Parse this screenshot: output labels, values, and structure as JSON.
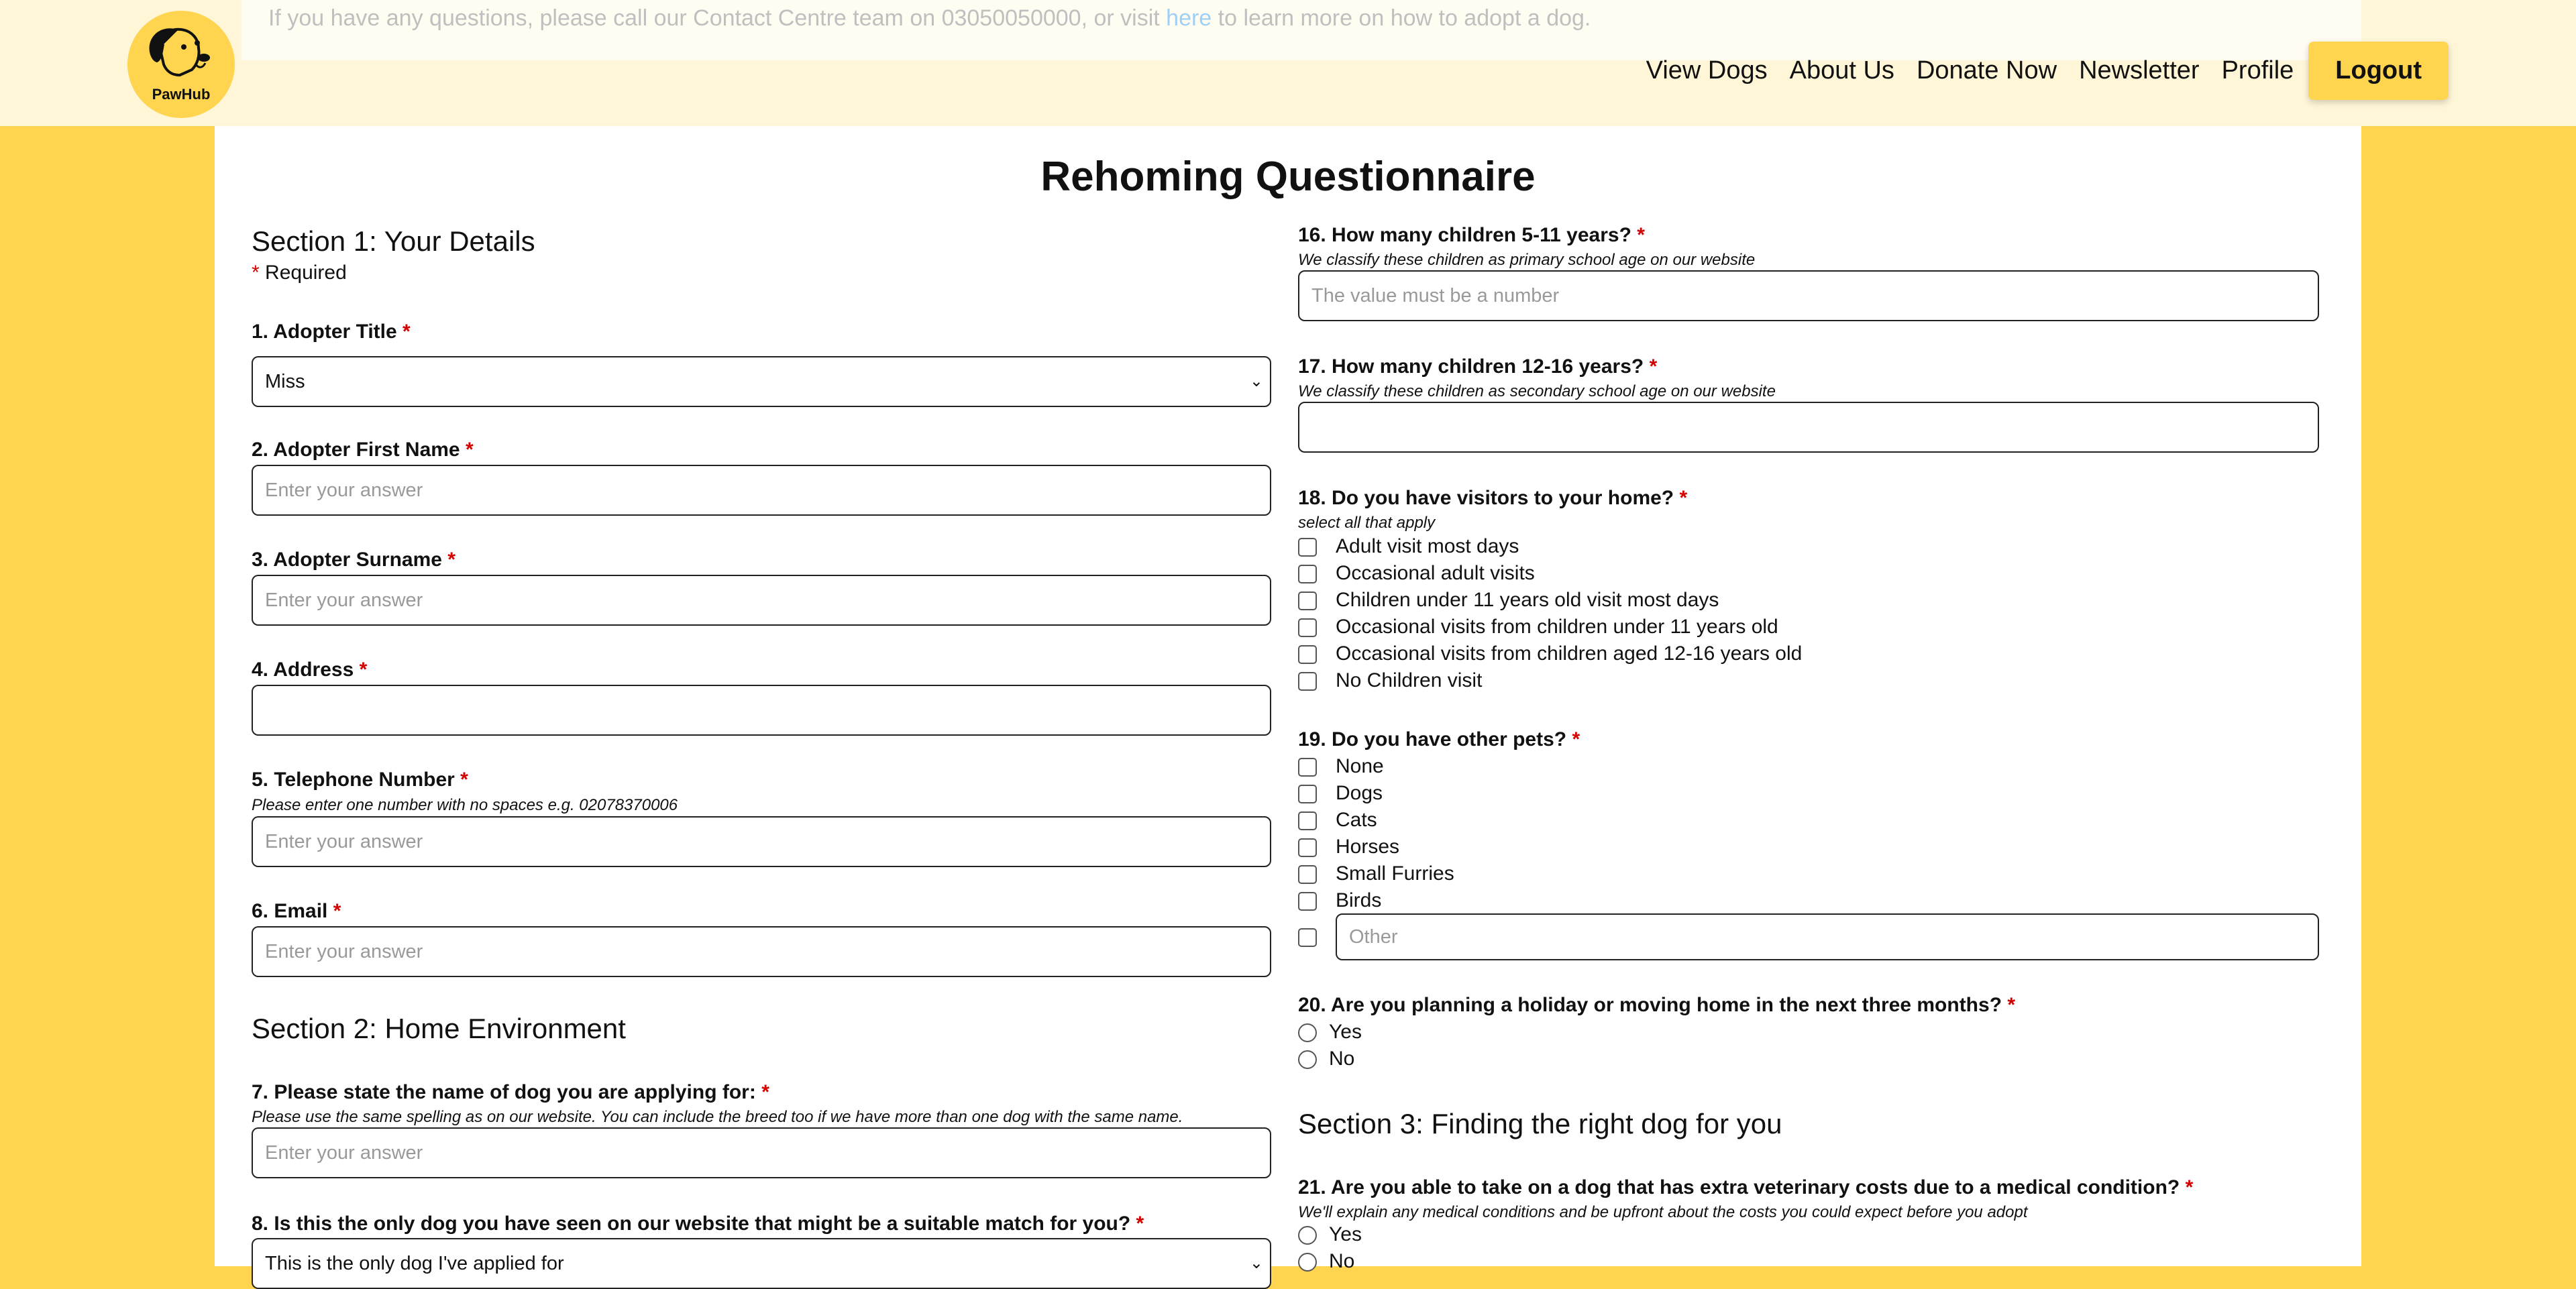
{
  "brand": {
    "logo_text": "PawHub"
  },
  "notice": {
    "text_before": "If you have any questions, please call our Contact Centre team on 03050050000, or visit ",
    "link": "here",
    "text_after": " to learn more on how to adopt a dog."
  },
  "nav": {
    "items": [
      "View Dogs",
      "About Us",
      "Donate Now",
      "Newsletter",
      "Profile"
    ],
    "logout": "Logout"
  },
  "page_title": "Rehoming Questionnaire",
  "required_mark": "*",
  "section1": {
    "title": "Section 1: Your Details",
    "required_note": "Required",
    "q1": {
      "label": "1. Adopter Title",
      "value": "Miss"
    },
    "q2": {
      "label": "2. Adopter First Name",
      "placeholder": "Enter your answer"
    },
    "q3": {
      "label": "3. Adopter Surname",
      "placeholder": "Enter your answer"
    },
    "q4": {
      "label": "4. Address",
      "value": ""
    },
    "q5": {
      "label": "5. Telephone Number",
      "hint": "Please enter one number with no spaces e.g. 02078370006",
      "placeholder": "Enter your answer"
    },
    "q6": {
      "label": "6. Email",
      "placeholder": "Enter your answer"
    }
  },
  "section2": {
    "title": "Section 2: Home Environment",
    "q7": {
      "label": "7. Please state the name of dog you are applying for:",
      "hint": "Please use the same spelling as on our website. You can include the breed too if we have more than one dog with the same name.",
      "placeholder": "Enter your answer"
    },
    "q8": {
      "label": "8. Is this the only dog you have seen on our website that might be a suitable match for you?",
      "value": "This is the only dog I've applied for"
    },
    "q16": {
      "label": "16. How many children 5-11 years?",
      "hint": "We classify these children as primary school age on our website",
      "placeholder": "The value must be a number"
    },
    "q17": {
      "label": "17. How many children 12-16 years?",
      "hint": "We classify these children as secondary school age on our website",
      "value": ""
    },
    "q18": {
      "label": "18. Do you have visitors to your home?",
      "hint": "select all that apply",
      "options": [
        "Adult visit most days",
        "Occasional adult visits",
        "Children under 11 years old visit most days",
        "Occasional visits from children under 11 years old",
        "Occasional visits from children aged 12-16 years old",
        "No Children visit"
      ]
    },
    "q19": {
      "label": "19. Do you have other pets?",
      "options": [
        "None",
        "Dogs",
        "Cats",
        "Horses",
        "Small Furries",
        "Birds"
      ],
      "other_placeholder": "Other"
    },
    "q20": {
      "label": "20. Are you planning a holiday or moving home in the next three months?",
      "options": [
        "Yes",
        "No"
      ]
    }
  },
  "section3": {
    "title": "Section 3: Finding the right dog for you",
    "q21": {
      "label": "21. Are you able to take on a dog that has extra veterinary costs due to a medical condition?",
      "hint": "We'll explain any medical conditions and be upfront about the costs you could expect before you adopt",
      "options": [
        "Yes",
        "No"
      ]
    }
  }
}
